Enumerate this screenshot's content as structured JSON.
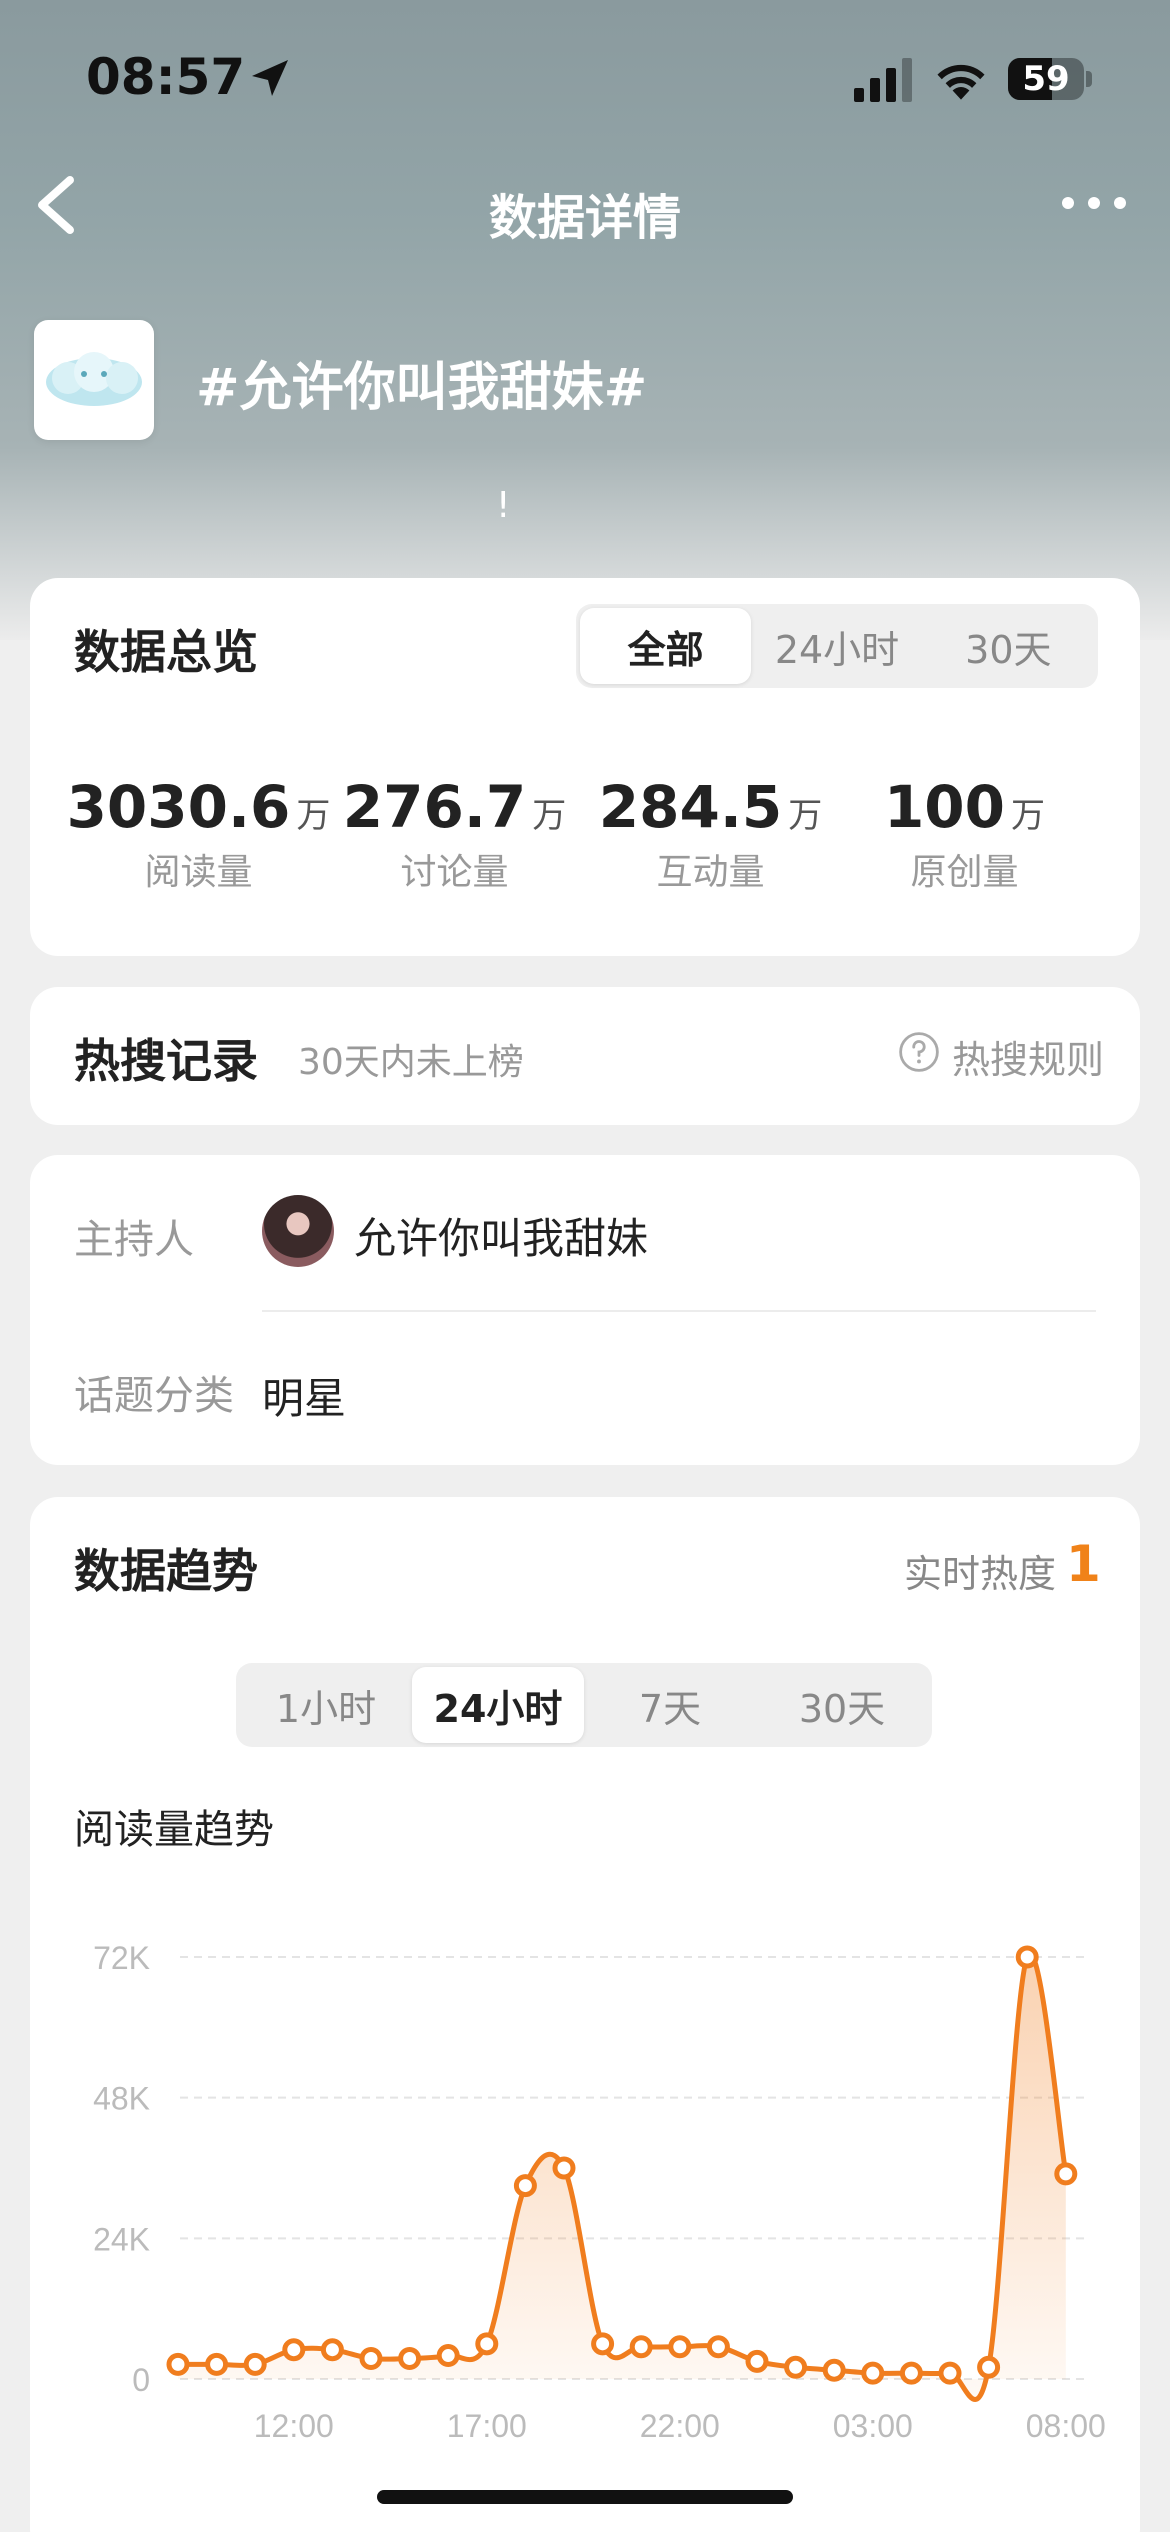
{
  "status_bar": {
    "time": "08:57",
    "battery": "59"
  },
  "nav": {
    "title": "数据详情"
  },
  "topic": {
    "title": "#允许你叫我甜妹#",
    "mark": "!"
  },
  "overview": {
    "title": "数据总览",
    "tabs": [
      "全部",
      "24小时",
      "30天"
    ],
    "active_tab": 0,
    "stats": [
      {
        "value": "3030.6",
        "unit": "万",
        "label": "阅读量"
      },
      {
        "value": "276.7",
        "unit": "万",
        "label": "讨论量"
      },
      {
        "value": "284.5",
        "unit": "万",
        "label": "互动量"
      },
      {
        "value": "100",
        "unit": "万",
        "label": "原创量"
      }
    ]
  },
  "hot_search": {
    "title": "热搜记录",
    "subtitle": "30天内未上榜",
    "rule_label": "热搜规则"
  },
  "info": {
    "host_label": "主持人",
    "host_name": "允许你叫我甜妹",
    "category_label": "话题分类",
    "category_value": "明星"
  },
  "trend": {
    "title": "数据趋势",
    "heat_label": "实时热度",
    "heat_value": "1",
    "tabs": [
      "1小时",
      "24小时",
      "7天",
      "30天"
    ],
    "active_tab": 1,
    "chart_title": "阅读量趋势"
  },
  "chart_data": {
    "type": "area",
    "title": "阅读量趋势",
    "x_tick_labels": [
      "12:00",
      "17:00",
      "22:00",
      "03:00",
      "08:00"
    ],
    "y_tick_labels": [
      "0",
      "24K",
      "48K",
      "72K"
    ],
    "ylim": [
      0,
      72000
    ],
    "grid": true,
    "color": "#f07d1e",
    "x": [
      "09:00",
      "10:00",
      "11:00",
      "12:00",
      "13:00",
      "14:00",
      "15:00",
      "16:00",
      "17:00",
      "18:00",
      "19:00",
      "20:00",
      "21:00",
      "22:00",
      "23:00",
      "00:00",
      "01:00",
      "02:00",
      "03:00",
      "04:00",
      "05:00",
      "06:00",
      "07:00",
      "08:00",
      "09:00"
    ],
    "values": [
      2500,
      2500,
      2500,
      5000,
      5000,
      3500,
      3500,
      4000,
      6000,
      33000,
      36000,
      6000,
      5500,
      5500,
      5500,
      3000,
      2000,
      1500,
      1000,
      1000,
      1000,
      2000,
      72000,
      35000
    ]
  }
}
